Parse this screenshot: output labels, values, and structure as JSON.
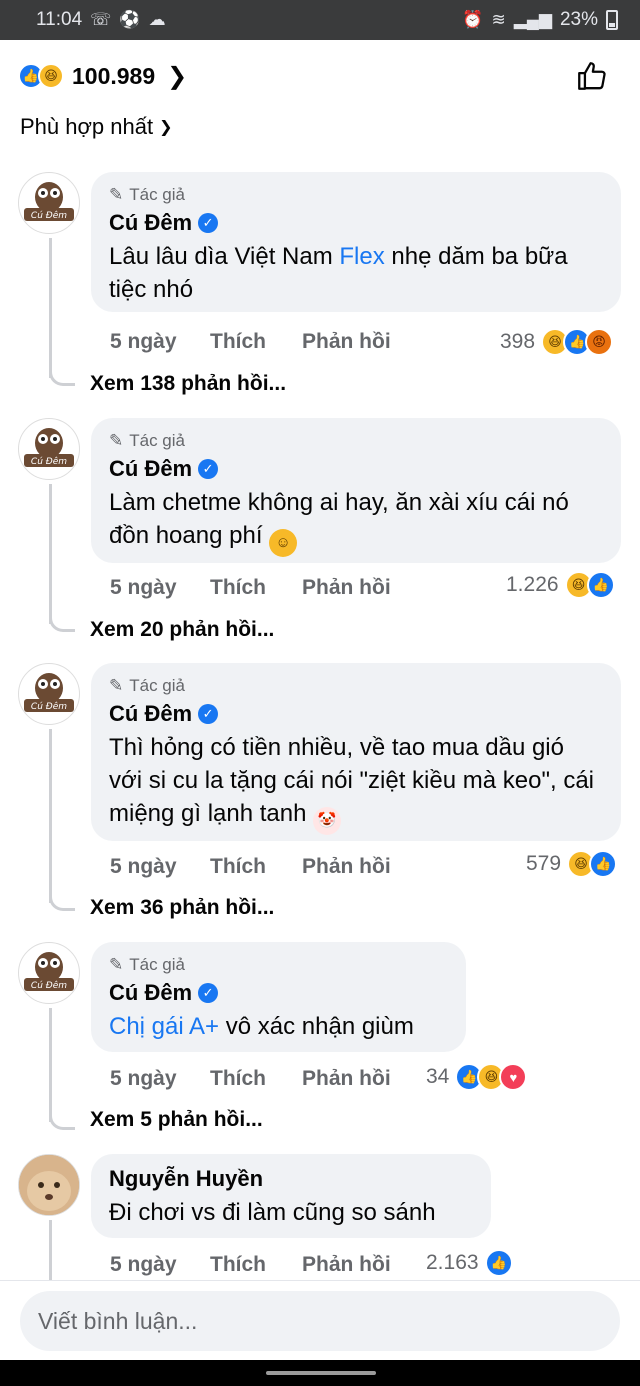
{
  "status_bar": {
    "time": "11:04",
    "battery": "23%"
  },
  "header": {
    "reaction_count": "100.989",
    "sort_label": "Phù hợp nhất"
  },
  "comments": [
    {
      "author_tag": "Tác giả",
      "author": "Cú Đêm",
      "verified": true,
      "text_lines": [
        "Lâu lâu dìa Việt Nam ",
        "Flex",
        " nhẹ dăm ba bữa tiệc nhó"
      ],
      "time": "5 ngày",
      "like_label": "Thích",
      "reply_label": "Phản hồi",
      "reaction_count": "398",
      "reactions": [
        "haha",
        "like",
        "angry"
      ],
      "view_replies": "Xem 138 phản hồi..."
    },
    {
      "author_tag": "Tác giả",
      "author": "Cú Đêm",
      "verified": true,
      "text": "Làm chetme không ai hay, ăn xài xíu cái nó đồn hoang phí",
      "time": "5 ngày",
      "like_label": "Thích",
      "reply_label": "Phản hồi",
      "reaction_count": "1.226",
      "reactions": [
        "haha",
        "like"
      ],
      "view_replies": "Xem 20 phản hồi..."
    },
    {
      "author_tag": "Tác giả",
      "author": "Cú Đêm",
      "verified": true,
      "text": "Thì hỏng có tiền nhiều, về tao mua dầu gió với si cu la tặng cái nói \"ziệt kiều mà keo\", cái miệng gì lạnh tanh",
      "time": "5 ngày",
      "like_label": "Thích",
      "reply_label": "Phản hồi",
      "reaction_count": "579",
      "reactions": [
        "haha",
        "like"
      ],
      "view_replies": "Xem 36 phản hồi..."
    },
    {
      "author_tag": "Tác giả",
      "author": "Cú Đêm",
      "verified": true,
      "text_link": "Chị gái A+",
      "text_rest": " vô xác nhận giùm",
      "time": "5 ngày",
      "like_label": "Thích",
      "reply_label": "Phản hồi",
      "reaction_count": "34",
      "reactions": [
        "like",
        "haha",
        "love"
      ],
      "view_replies": "Xem 5 phản hồi..."
    },
    {
      "author": "Nguyễn Huyền",
      "verified": false,
      "text": "Đi chơi vs đi làm cũng so sánh",
      "time": "5 ngày",
      "like_label": "Thích",
      "reply_label": "Phản hồi",
      "reaction_count": "2.163",
      "reactions": [
        "like"
      ]
    }
  ],
  "avatar_label": "Cú Đêm",
  "composer": {
    "placeholder": "Viết bình luận..."
  },
  "colors": {
    "accent": "#1877f2",
    "bubble": "#f0f2f5",
    "muted": "#65676b"
  }
}
